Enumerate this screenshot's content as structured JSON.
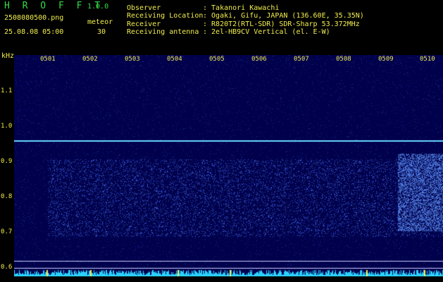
{
  "app": {
    "name": "H R O F F T",
    "version": "1.0.0"
  },
  "file": {
    "name": "2508080500.png",
    "datetime": "25.08.08 05:00"
  },
  "meteor": {
    "label": "meteor",
    "count": "30"
  },
  "station": [
    {
      "key": "Observer",
      "value": ": Takanori Kawachi"
    },
    {
      "key": "Receiving Location",
      "value": ": Ogaki, Gifu, JAPAN (136.60E, 35.35N)"
    },
    {
      "key": "Receiver",
      "value": ": R820T2(RTL-SDR) SDR-Sharp 53.372MHz"
    },
    {
      "key": "Receiving antenna",
      "value": ": 2el-HB9CV Vertical (el. E-W)"
    }
  ],
  "spectrogram": {
    "y_unit": "kHz",
    "y_ticks": [
      "1.1",
      "1.0",
      "0.9",
      "0.8",
      "0.7",
      "0.6"
    ],
    "x_ticks": [
      "0501",
      "0502",
      "0503",
      "0504",
      "0505",
      "0506",
      "0507",
      "0508",
      "0509",
      "0510"
    ],
    "colors": {
      "background": "#00004c",
      "signal": "#4a6cff",
      "carrier": "#6ad8ff",
      "bottom_strip": "#2ad0ff",
      "spike": "#f2ee4c"
    }
  }
}
